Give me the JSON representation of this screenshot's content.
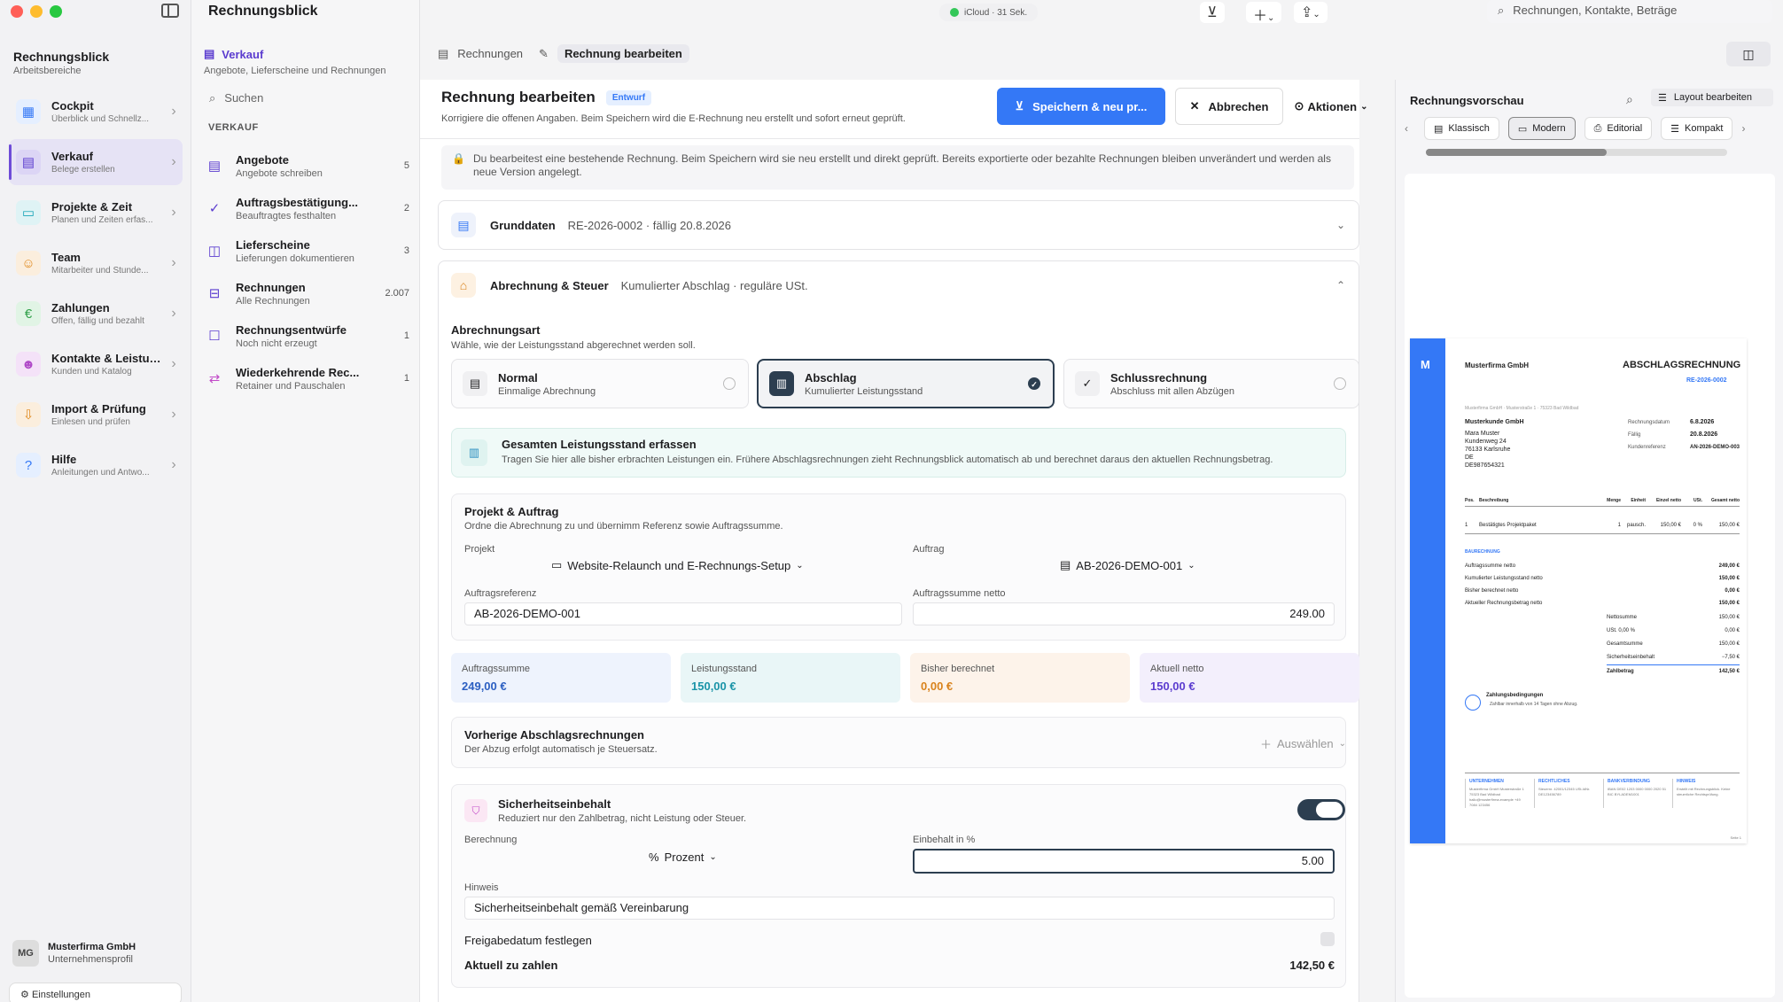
{
  "window": {
    "app_name": "Rechnungsblick"
  },
  "sidebar": {
    "workspace_title": "Rechnungsblick",
    "workspace_sub": "Arbeitsbereiche",
    "items": [
      {
        "label": "Cockpit",
        "sub": "Überblick und Schnellz...",
        "icon": "grid-icon",
        "color": "#3478f6"
      },
      {
        "label": "Verkauf",
        "sub": "Belege erstellen",
        "icon": "document-icon",
        "color": "#5b3ccf"
      },
      {
        "label": "Projekte & Zeit",
        "sub": "Planen und Zeiten erfas...",
        "icon": "briefcase-icon",
        "color": "#1aa5b8"
      },
      {
        "label": "Team",
        "sub": "Mitarbeiter und Stunde...",
        "icon": "team-icon",
        "color": "#e08a1e"
      },
      {
        "label": "Zahlungen",
        "sub": "Offen, fällig und bezahlt",
        "icon": "euro-icon",
        "color": "#2e9f48"
      },
      {
        "label": "Kontakte & Leistun...",
        "sub": "Kunden und Katalog",
        "icon": "contacts-icon",
        "color": "#b04ac8"
      },
      {
        "label": "Import & Prüfung",
        "sub": "Einlesen und prüfen",
        "icon": "import-icon",
        "color": "#e08a1e"
      },
      {
        "label": "Hilfe",
        "sub": "Anleitungen und Antwo...",
        "icon": "help-icon",
        "color": "#3478f6"
      }
    ],
    "company_initials": "MG",
    "company_name": "Musterfirma GmbH",
    "company_sub": "Unternehmensprofil",
    "settings_label": "Einstellungen"
  },
  "sales": {
    "title": "Verkauf",
    "subtitle": "Angebote, Lieferscheine und Rechnungen",
    "search_placeholder": "Suchen",
    "section": "VERKAUF",
    "items": [
      {
        "label": "Angebote",
        "desc": "Angebote schreiben",
        "count": "5"
      },
      {
        "label": "Auftragsbestätigung...",
        "desc": "Beauftragtes festhalten",
        "count": "2"
      },
      {
        "label": "Lieferscheine",
        "desc": "Lieferungen dokumentieren",
        "count": "3"
      },
      {
        "label": "Rechnungen",
        "desc": "Alle Rechnungen",
        "count": "2.007"
      },
      {
        "label": "Rechnungsentwürfe",
        "desc": "Noch nicht erzeugt",
        "count": "1"
      },
      {
        "label": "Wiederkehrende Rec...",
        "desc": "Retainer und Pauschalen",
        "count": "1"
      }
    ]
  },
  "topbar": {
    "icloud_status": "iCloud · 31 Sek.",
    "search_placeholder": "Rechnungen, Kontakte, Beträge"
  },
  "breadcrumb": {
    "parent": "Rechnungen",
    "current": "Rechnung bearbeiten"
  },
  "editor": {
    "title": "Rechnung bearbeiten",
    "badge": "Entwurf",
    "description": "Korrigiere die offenen Angaben. Beim Speichern wird die E-Rechnung neu erstellt und sofort erneut geprüft.",
    "save_label": "Speichern & neu pr...",
    "cancel_label": "Abbrechen",
    "actions_label": "Aktionen",
    "notice": "Du bearbeitest eine bestehende Rechnung. Beim Speichern wird sie neu erstellt und direkt geprüft. Bereits exportierte oder bezahlte Rechnungen bleiben unverändert und werden als neue Version angelegt.",
    "basic": {
      "title": "Grunddaten",
      "meta": "RE-2026-0002 · fällig 20.8.2026"
    },
    "billing": {
      "title": "Abrechnung & Steuer",
      "meta": "Kumulierter Abschlag · reguläre USt.",
      "type_title": "Abrechnungsart",
      "type_desc": "Wähle, wie der Leistungsstand abgerechnet werden soll.",
      "options": [
        {
          "name": "Normal",
          "desc": "Einmalige Abrechnung"
        },
        {
          "name": "Abschlag",
          "desc": "Kumulierter Leistungsstand"
        },
        {
          "name": "Schlussrechnung",
          "desc": "Abschluss mit allen Abzügen"
        }
      ],
      "info_title": "Gesamten Leistungsstand erfassen",
      "info_desc": "Tragen Sie hier alle bisher erbrachten Leistungen ein. Frühere Abschlagsrechnungen zieht Rechnungsblick automatisch ab und berechnet daraus den aktuellen Rechnungsbetrag.",
      "project": {
        "title": "Projekt & Auftrag",
        "desc": "Ordne die Abrechnung zu und übernimm Referenz sowie Auftragssumme.",
        "project_label": "Projekt",
        "project_value": "Website-Relaunch und E-Rechnungs-Setup",
        "order_label": "Auftrag",
        "order_value": "AB-2026-DEMO-001",
        "ref_label": "Auftragsreferenz",
        "ref_value": "AB-2026-DEMO-001",
        "sum_label": "Auftragssumme netto",
        "sum_value": "249.00"
      },
      "stats": [
        {
          "label": "Auftragssumme",
          "value": "249,00 €",
          "bg": "#eef3fd",
          "color": "#2c5fc2"
        },
        {
          "label": "Leistungsstand",
          "value": "150,00 €",
          "bg": "#e9f6f7",
          "color": "#1a94a8"
        },
        {
          "label": "Bisher berechnet",
          "value": "0,00 €",
          "bg": "#fdf3ea",
          "color": "#d9831d"
        },
        {
          "label": "Aktuell netto",
          "value": "150,00 €",
          "bg": "#f3effc",
          "color": "#5b3ccf"
        }
      ],
      "previous": {
        "title": "Vorherige Abschlagsrechnungen",
        "desc": "Der Abzug erfolgt automatisch je Steuersatz.",
        "select_label": "Auswählen"
      },
      "retention": {
        "title": "Sicherheitseinbehalt",
        "desc": "Reduziert nur den Zahlbetrag, nicht Leistung oder Steuer.",
        "calc_label": "Berechnung",
        "calc_value": "Prozent",
        "percent_label": "Einbehalt in %",
        "percent_value": "5.00",
        "note_label": "Hinweis",
        "note_value": "Sicherheitseinbehalt gemäß Vereinbarung",
        "release_label": "Freigabedatum festlegen",
        "due_label": "Aktuell zu zahlen",
        "due_value": "142,50 €"
      }
    }
  },
  "preview": {
    "title": "Rechnungsvorschau",
    "layout_label": "Layout bearbeiten",
    "tabs": [
      "Klassisch",
      "Modern",
      "Editorial",
      "Kompakt"
    ],
    "doc": {
      "logo_letter": "M",
      "company": "Musterfirma GmbH",
      "title": "ABSCHLAGSRECHNUNG",
      "number": "RE-2026-0002",
      "sender_line": "Musterfirma GmbH · Musterstraße 1 · 75323 Bad Wildbad",
      "address": [
        "Musterkunde GmbH",
        "Mara Muster",
        "Kundenweg 24",
        "76133 Karlsruhe",
        "DE",
        "DE987654321"
      ],
      "meta": [
        {
          "k": "Rechnungsdatum",
          "v": "6.8.2026"
        },
        {
          "k": "Fällig",
          "v": "20.8.2026"
        },
        {
          "k": "Kundenreferenz",
          "v": "AN-2026-DEMO-003"
        }
      ],
      "table_head": [
        "Pos.",
        "Beschreibung",
        "Menge",
        "Einheit",
        "Einzel netto",
        "USt.",
        "Gesamt netto"
      ],
      "table_row": [
        "1",
        "Bestätigtes Projektpaket",
        "1",
        "pausch.",
        "150,00 €",
        "0 %",
        "150,00 €"
      ],
      "bau_head": "BAURECHNUNG",
      "bau_rows": [
        {
          "k": "Auftragssumme netto",
          "v": "249,00 €"
        },
        {
          "k": "Kumulierter Leistungsstand netto",
          "v": "150,00 €"
        },
        {
          "k": "Bisher berechnet netto",
          "v": "0,00 €"
        },
        {
          "k": "Aktueller Rechnungsbetrag netto",
          "v": "150,00 €"
        }
      ],
      "sums": [
        {
          "k": "Nettosumme",
          "v": "150,00 €"
        },
        {
          "k": "USt. 0,00 %",
          "v": "0,00 €"
        },
        {
          "k": "Gesamtsumme",
          "v": "150,00 €"
        },
        {
          "k": "Sicherheitseinbehalt",
          "v": "−7,50 €"
        },
        {
          "k": "Zahlbetrag",
          "v": "142,50 €"
        }
      ],
      "payment_title": "Zahlungsbedingungen",
      "payment_desc": "Zahlbar innerhalb von 14 Tagen ohne Abzug.",
      "footer": [
        {
          "h": "UNTERNEHMEN",
          "t": "Musterfirma GmbH Musterstraße 1 75323 Bad Wildbad hallo@musterfirma.example +49 7084 123456"
        },
        {
          "h": "RECHTLICHES",
          "t": "Steuernr. 42001/12345 USt-IdNr. DE123456789"
        },
        {
          "h": "BANKVERBINDUNG",
          "t": "IBAN DE02 1203 0000 0000 2020 51 BIC BYLADEM1001"
        },
        {
          "h": "HINWEIS",
          "t": "Erstellt mit Rechnungsblick. Keine steuerliche Rechtsprüfung."
        }
      ],
      "page": "Seite 1"
    }
  }
}
